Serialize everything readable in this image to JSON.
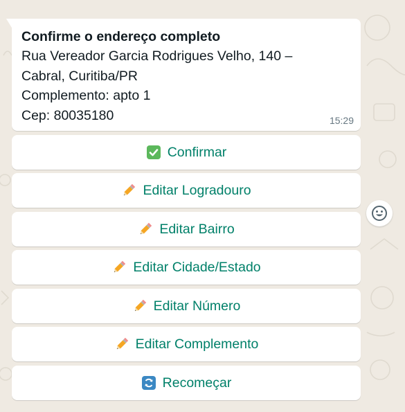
{
  "message": {
    "title": "Confirme o endereço completo",
    "lines": [
      "Rua Vereador Garcia Rodrigues Velho, 140 –",
      "Cabral, Curitiba/PR",
      "Complemento: apto 1",
      "Cep: 80035180"
    ],
    "time": "15:29"
  },
  "buttons": [
    {
      "label": "Confirmar",
      "icon": "check-box-icon"
    },
    {
      "label": "Editar Logradouro",
      "icon": "pencil-icon"
    },
    {
      "label": "Editar Bairro",
      "icon": "pencil-icon"
    },
    {
      "label": "Editar Cidade/Estado",
      "icon": "pencil-icon"
    },
    {
      "label": "Editar Número",
      "icon": "pencil-icon"
    },
    {
      "label": "Editar Complemento",
      "icon": "pencil-icon"
    },
    {
      "label": "Recomeçar",
      "icon": "refresh-icon"
    }
  ],
  "colors": {
    "background": "#efeae2",
    "bubble": "#ffffff",
    "button_text": "#008069",
    "text": "#111b21",
    "timestamp": "#667781"
  }
}
